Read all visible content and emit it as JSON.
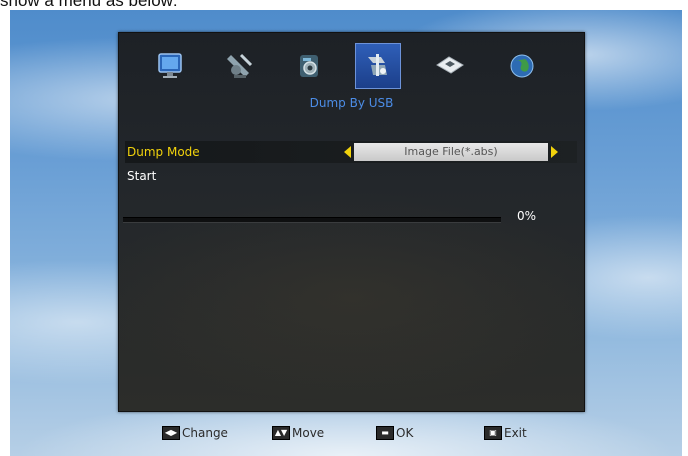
{
  "caption": "show a menu as below:",
  "menu": {
    "title": "Dump By USB",
    "icons": [
      {
        "name": "monitor-icon",
        "active": false
      },
      {
        "name": "satellite-dish-icon",
        "active": false
      },
      {
        "name": "camera-icon",
        "active": false
      },
      {
        "name": "tools-icon",
        "active": true
      },
      {
        "name": "usb-drive-icon",
        "active": false
      },
      {
        "name": "globe-icon",
        "active": false
      }
    ]
  },
  "rows": {
    "dump_mode": {
      "label": "Dump Mode",
      "value": "Image File(*.abs)"
    },
    "start": {
      "label": "Start"
    }
  },
  "progress": {
    "value_percent": 0,
    "label": "0%"
  },
  "footer": {
    "change": "Change",
    "move": "Move",
    "ok": "OK",
    "exit": "Exit"
  },
  "colors": {
    "highlight": "#f1d20c",
    "title": "#4c8de6",
    "active_tab": "#2f5fb8"
  }
}
